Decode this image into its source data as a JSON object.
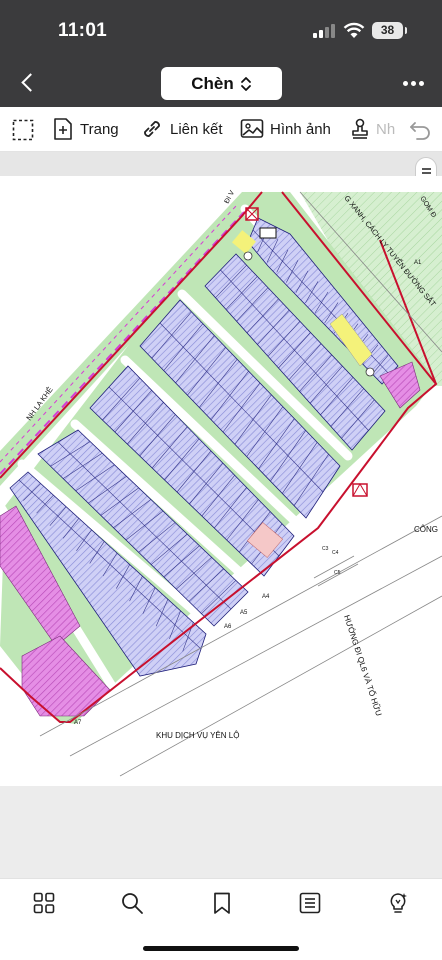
{
  "status_bar": {
    "time": "11:01",
    "battery": "38"
  },
  "nav": {
    "title": "Chèn"
  },
  "toolbar": {
    "page_label": "Trang",
    "link_label": "Liên kết",
    "image_label": "Hình ảnh",
    "stamp_label": "Nh"
  },
  "map": {
    "label_road_top": "ĐI V",
    "label_green_belt": "G XANH, CÁCH LY TUYẾN ĐƯỜNG SẮT",
    "label_gom": "GOM Đ",
    "label_left": "NH LA KHÊ",
    "label_cong": "CÔNG",
    "label_bottom": "KHU DỊCH VỤ YÊN LỘ",
    "label_direction": "HƯỚNG ĐI QL6 VÀ TỐ HỮU",
    "label_a1": "A1",
    "label_a4": "A4",
    "label_a5": "A5",
    "label_a6": "A6",
    "label_a7": "A7",
    "label_c3": "C3",
    "label_c4": "C4",
    "label_c5": "C5"
  },
  "colors": {
    "dark_bar": "#3b3b3d",
    "boundary": "#c8102e",
    "green": "#b9e3b0",
    "lots": "#c9c9f4",
    "pink": "#e07ee0",
    "yellow": "#f4f27a"
  },
  "icons": [
    "back-icon",
    "chevron-updown-icon",
    "more-icon",
    "select-area-icon",
    "add-page-icon",
    "link-icon",
    "image-icon",
    "stamp-icon",
    "undo-icon",
    "grid-icon",
    "search-icon",
    "bookmark-icon",
    "list-icon",
    "ai-bulb-icon"
  ]
}
